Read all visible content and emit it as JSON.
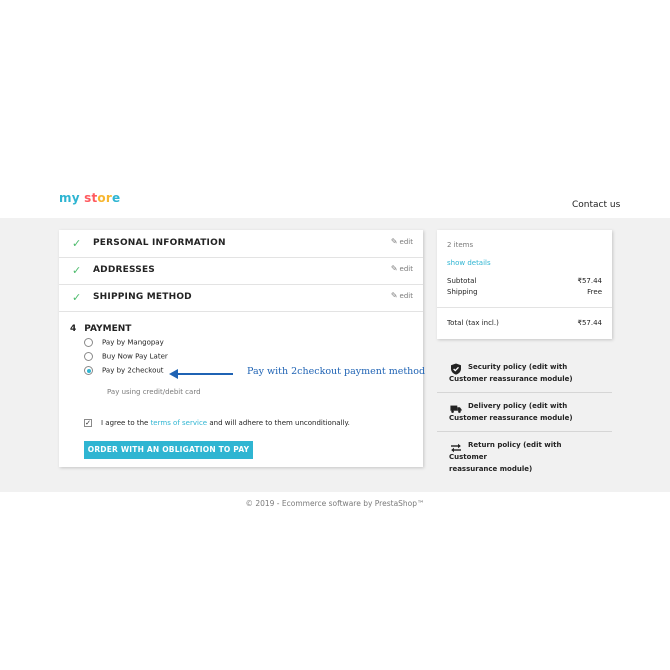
{
  "header": {
    "logo": {
      "my": "my",
      "st": "st",
      "or": "or",
      "e": "e"
    },
    "contact_label": "Contact us"
  },
  "checkout": {
    "steps": [
      {
        "title": "PERSONAL INFORMATION",
        "edit_label": "edit",
        "completed": true
      },
      {
        "title": "ADDRESSES",
        "edit_label": "edit",
        "completed": true
      },
      {
        "title": "SHIPPING METHOD",
        "edit_label": "edit",
        "completed": true
      }
    ],
    "payment": {
      "number": "4",
      "title": "PAYMENT",
      "options": [
        {
          "label": "Pay by Mangopay",
          "selected": false
        },
        {
          "label": "Buy Now Pay Later",
          "selected": false
        },
        {
          "label": "Pay by 2checkout",
          "selected": true
        }
      ],
      "selected_note": "Pay using credit/debit card",
      "terms": {
        "prefix": "I agree to the",
        "link": "terms of service",
        "suffix": "and will adhere to them unconditionally.",
        "checked": true
      },
      "order_button": "ORDER WITH AN OBLIGATION TO PAY"
    }
  },
  "annotation": {
    "text": "Pay with 2checkout payment method",
    "color": "#1f63b4"
  },
  "summary": {
    "items_count": "2 items",
    "show_details": "show details",
    "subtotal_label": "Subtotal",
    "subtotal_value": "₹57.44",
    "shipping_label": "Shipping",
    "shipping_value": "Free",
    "total_label": "Total (tax incl.)",
    "total_value": "₹57.44"
  },
  "reassurance": [
    {
      "icon": "shield-icon",
      "text_first": "Security policy (edit with",
      "text_rest": "Customer reassurance module)"
    },
    {
      "icon": "truck-icon",
      "text_first": "Delivery policy (edit with",
      "text_rest": "Customer reassurance module)"
    },
    {
      "icon": "exchange-arrows-icon",
      "text_first": "Return policy (edit with Customer",
      "text_rest": "reassurance module)"
    }
  ],
  "footer": {
    "text": "© 2019 - Ecommerce software by PrestaShop™"
  },
  "colors": {
    "accent": "#2fb5d2",
    "check_green": "#4cbb6c",
    "page_bg": "#f1f1f1"
  }
}
